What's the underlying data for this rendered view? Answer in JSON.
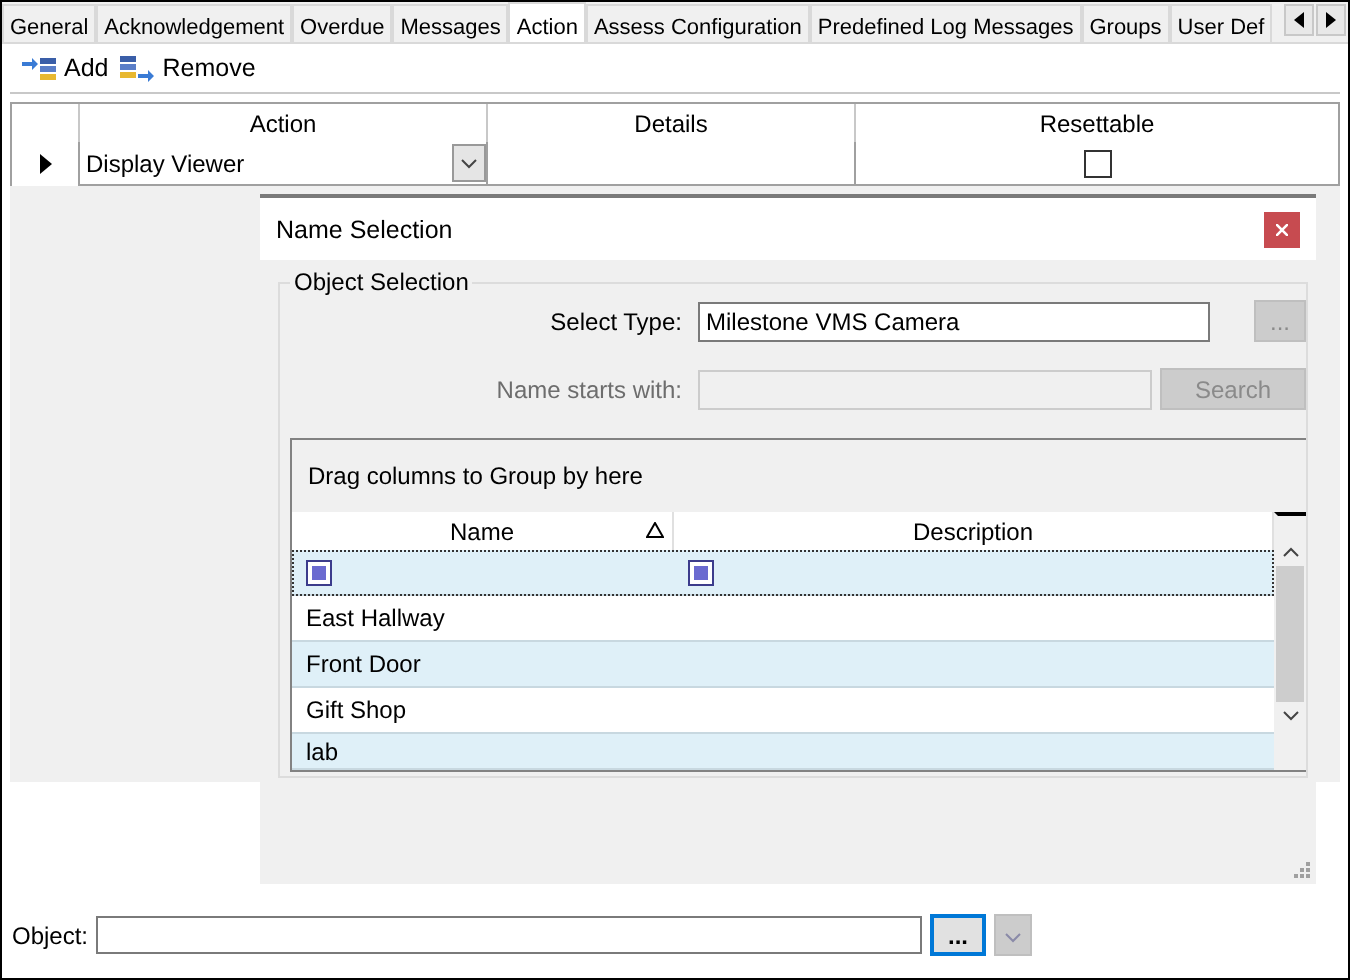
{
  "tabs": [
    {
      "label": "General",
      "selected": false
    },
    {
      "label": "Acknowledgement",
      "selected": false
    },
    {
      "label": "Overdue",
      "selected": false
    },
    {
      "label": "Messages",
      "selected": false
    },
    {
      "label": "Action",
      "selected": true
    },
    {
      "label": "Assess Configuration",
      "selected": false
    },
    {
      "label": "Predefined Log Messages",
      "selected": false
    },
    {
      "label": "Groups",
      "selected": false
    },
    {
      "label": "User Def",
      "selected": false
    }
  ],
  "toolbar": [
    {
      "label": "Add",
      "kind": "add"
    },
    {
      "label": "Remove",
      "kind": "remove"
    }
  ],
  "actions_grid": {
    "columns": [
      "Action",
      "Details",
      "Resettable"
    ],
    "rows": [
      {
        "current": true,
        "action": "Display Viewer",
        "resettable": false
      }
    ]
  },
  "dialog": {
    "title": "Name Selection",
    "group_title": "Object Selection",
    "select_type": {
      "label": "Select Type:",
      "value": "Milestone VMS Camera",
      "button": "...",
      "button_disabled": true
    },
    "name_filter": {
      "label": "Name starts with:",
      "disabled": true,
      "button": "Search"
    },
    "grid": {
      "group_by_hint": "Drag columns to Group by here",
      "columns": [
        {
          "label": "Name",
          "sorted": true
        },
        {
          "label": "Description",
          "sorted": false
        }
      ],
      "rows": [
        {
          "name": "East Hallway"
        },
        {
          "name": "Front Door"
        },
        {
          "name": "Gift Shop"
        },
        {
          "name": "lab"
        }
      ]
    }
  },
  "object_field": {
    "label": "Object:",
    "button": "...",
    "focused": true
  }
}
